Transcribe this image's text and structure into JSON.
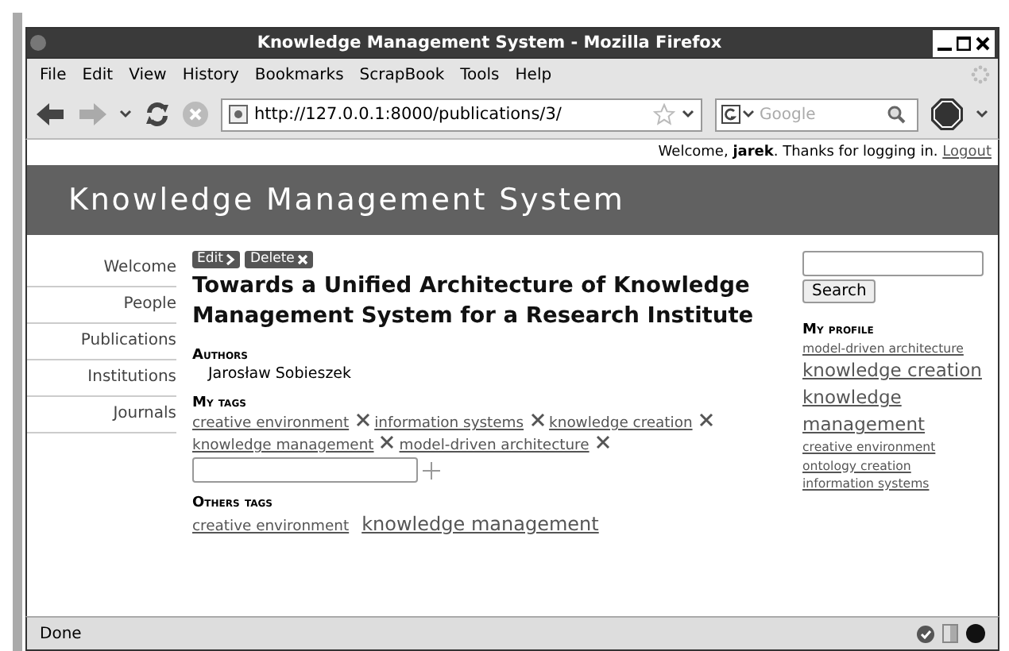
{
  "window": {
    "title": "Knowledge Management System - Mozilla Firefox"
  },
  "menu": [
    "File",
    "Edit",
    "View",
    "History",
    "Bookmarks",
    "ScrapBook",
    "Tools",
    "Help"
  ],
  "toolbar": {
    "url": "http://127.0.0.1:8000/publications/3/",
    "search_placeholder": "Google"
  },
  "welcome": {
    "text": "Welcome, **jarek**. Thanks for logging in.",
    "logout": "Logout"
  },
  "site_title": "Knowledge Management System",
  "sidebar": {
    "items": [
      "Welcome",
      "People",
      "Publications",
      "Institutions",
      "Journals"
    ]
  },
  "actions": [
    "Edit",
    "Delete"
  ],
  "publication": {
    "title": "Towards a Unified Architecture of Knowledge Management System for a Research Institute",
    "authors_heading": "Authors",
    "authors": [
      "Jarosław Sobieszek"
    ],
    "my_tags_heading": "My tags",
    "my_tags": [
      "creative environment",
      "information systems",
      "knowledge creation",
      "knowledge management",
      "model-driven architecture"
    ],
    "others_heading": "Others tags",
    "others_tags": [
      {
        "label": "creative environment",
        "kind": "small"
      },
      {
        "label": "knowledge management",
        "kind": "large"
      }
    ]
  },
  "search": {
    "button": "Search"
  },
  "profile": {
    "heading": "My profile",
    "tags": [
      {
        "label": "model-driven architecture",
        "kind": "small"
      },
      {
        "label": "knowledge creation",
        "kind": "large"
      },
      {
        "label": "knowledge management",
        "kind": "large"
      },
      {
        "label": "creative environment",
        "kind": "small"
      },
      {
        "label": "ontology creation",
        "kind": "small"
      },
      {
        "label": "information systems",
        "kind": "small"
      }
    ]
  },
  "status_bar": {
    "text": "Done"
  }
}
